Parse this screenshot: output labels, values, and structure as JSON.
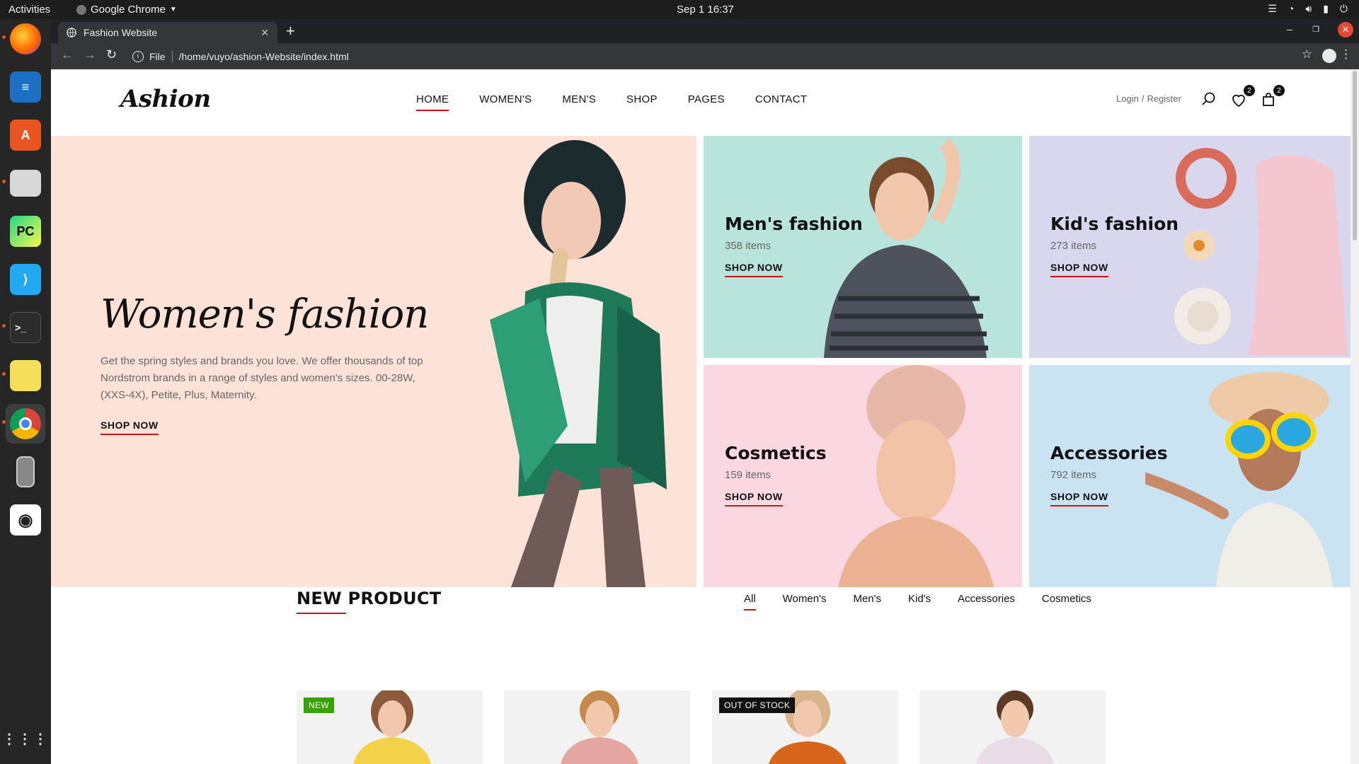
{
  "os": {
    "activities": "Activities",
    "app_name": "Google Chrome",
    "clock": "Sep 1  16:37"
  },
  "browser": {
    "tab_title": "Fashion Website",
    "url_scheme": "File",
    "url": "/home/vuyo/ashion-Website/index.html"
  },
  "site": {
    "logo": "Ashion",
    "nav": [
      "HOME",
      "WOMEN'S",
      "MEN'S",
      "SHOP",
      "PAGES",
      "CONTACT"
    ],
    "login": "Login",
    "register": "Register",
    "wishlist_count": "2",
    "cart_count": "2",
    "accent_color": "#ca1515"
  },
  "hero": {
    "title": "Women's fashion",
    "description": "Get the spring styles and brands you love. We offer thousands of top Nordstrom brands in a range of styles and women's sizes. 00-28W, (XXS-4X), Petite, Plus, Maternity.",
    "cta": "SHOP NOW",
    "bg_color": "#fde2d8"
  },
  "categories": [
    {
      "title": "Men's fashion",
      "count": "358 items",
      "cta": "SHOP NOW",
      "bg_color": "#b8e4db"
    },
    {
      "title": "Kid's fashion",
      "count": "273 items",
      "cta": "SHOP NOW",
      "bg_color": "#d9d7ee"
    },
    {
      "title": "Cosmetics",
      "count": "159 items",
      "cta": "SHOP NOW",
      "bg_color": "#fad8e1"
    },
    {
      "title": "Accessories",
      "count": "792 items",
      "cta": "SHOP NOW",
      "bg_color": "#c9e3f2"
    }
  ],
  "new_product": {
    "title": "NEW PRODUCT",
    "filters": [
      "All",
      "Women's",
      "Men's",
      "Kid's",
      "Accessories",
      "Cosmetics"
    ],
    "product_labels": [
      "NEW",
      "",
      "OUT OF STOCK",
      ""
    ]
  }
}
